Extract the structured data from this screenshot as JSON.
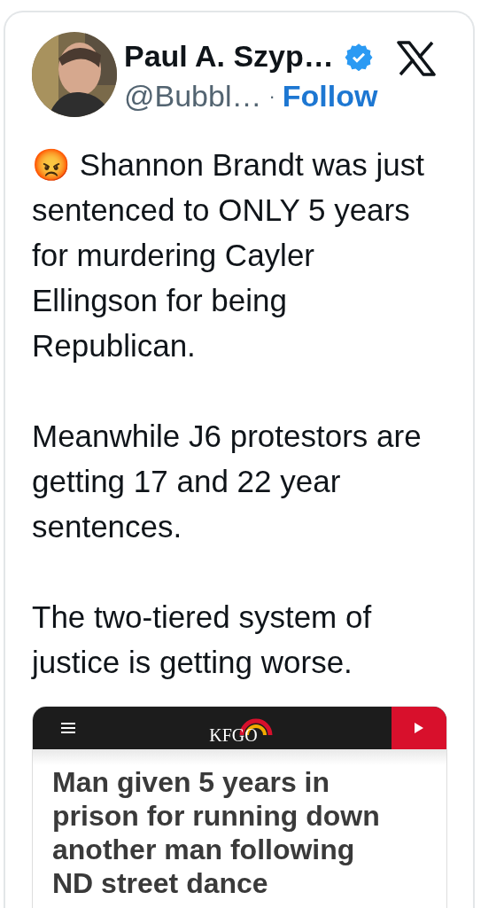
{
  "author": {
    "name": "Paul A. Szyp…",
    "verified": true,
    "handle": "@Bubbl…",
    "separator": "·",
    "follow": "Follow"
  },
  "paragraphs": [
    {
      "text": "😡 Shannon Brandt was just sentenced to ONLY 5 years for murdering Cayler Ellingson for being Republican."
    },
    {
      "text": "Meanwhile J6 protestors are getting 17 and 22 year sentences."
    },
    {
      "text": "The two-tiered system of justice is getting worse."
    }
  ],
  "link_card": {
    "logo": "KFGO",
    "headline": "Man given 5 years in prison for running down another man following ND street dance"
  }
}
